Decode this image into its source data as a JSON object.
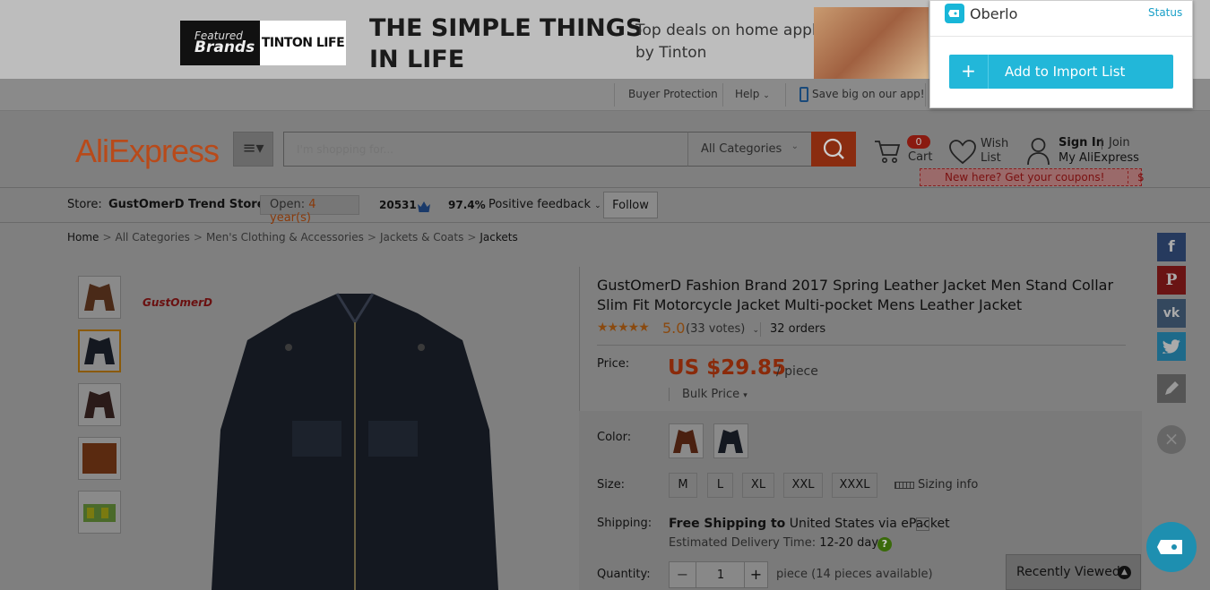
{
  "banner": {
    "featured_line1": "Featured",
    "featured_line2": "Brands",
    "brand_logo": "TINTON LIFE",
    "headline_1": "THE SIMPLE THINGS",
    "headline_2": "IN LIFE",
    "deals_1": "Top deals on home appliances",
    "deals_2": "by Tinton"
  },
  "topnav": {
    "buyer_protection": "Buyer Protection",
    "help": "Help",
    "app": "Save big on our app!"
  },
  "header": {
    "logo": "AliExpress",
    "search_placeholder": "I'm shopping for...",
    "category": "All Categories",
    "cart_count": "0",
    "cart_label": "Cart",
    "wish_1": "Wish",
    "wish_2": "List",
    "sign_in": "Sign In",
    "join": "Join",
    "my_account": "My AliExpress",
    "coupon": "New here? Get your coupons!",
    "coupon_symbol": "$"
  },
  "store": {
    "label": "Store:",
    "name": "GustOmerD Trend Store",
    "open_prefix": "Open:",
    "open_years": "4 year(s)",
    "score": "20531",
    "positive_pct": "97.4%",
    "positive_label": "Positive feedback",
    "follow": "Follow"
  },
  "breadcrumb": [
    "Home",
    "All Categories",
    "Men's Clothing & Accessories",
    "Jackets & Coats",
    "Jackets"
  ],
  "product": {
    "brand_mark": "GustOmerD",
    "title": "GustOmerD Fashion Brand 2017 Spring Leather Jacket Men Stand Collar Slim Fit Motorcycle Jacket Multi-pocket Mens Leather Jacket",
    "stars": "★★★★★",
    "rating": "5.0",
    "votes": "(33 votes)",
    "orders": "32 orders",
    "price_label": "Price:",
    "price": "US $29.85",
    "unit": "/ piece",
    "bulk": "Bulk Price",
    "color_label": "Color:",
    "size_label": "Size:",
    "sizes": [
      "M",
      "L",
      "XL",
      "XXL",
      "XXXL"
    ],
    "sizing_info": "Sizing info",
    "shipping_label": "Shipping:",
    "shipping_free": "Free Shipping to",
    "shipping_dest": "United States via ePacket",
    "est_label": "Estimated Delivery Time:",
    "est_value": "12-20 days",
    "quantity_label": "Quantity:",
    "quantity_value": "1",
    "availability": "piece (14 pieces available)",
    "recently_viewed": "Recently Viewed"
  },
  "social": {
    "facebook": "f",
    "pinterest": "P",
    "vk": "vk"
  },
  "oberlo": {
    "name": "Oberlo",
    "status": "Status",
    "button": "Add to Import List",
    "accent": "#22b7d9"
  }
}
